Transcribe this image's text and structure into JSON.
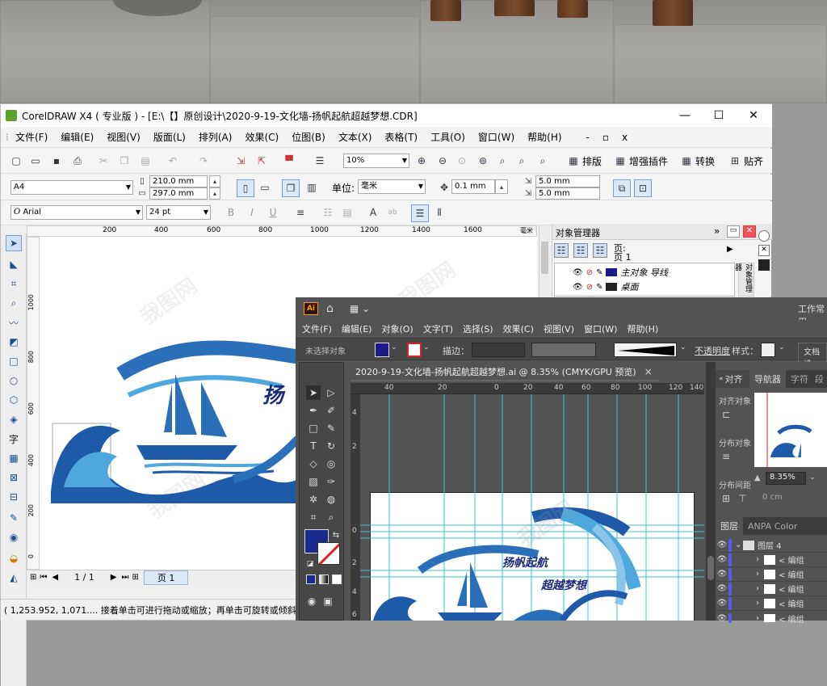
{
  "corel": {
    "title": "CorelDRAW X4 ( 专业版 ) - [E:\\【】原创设计\\2020-9-19-文化墙-扬帆起航超越梦想.CDR]",
    "window_controls": [
      "—",
      "☐",
      "✕"
    ],
    "menu": [
      "文件(F)",
      "编辑(E)",
      "视图(V)",
      "版面(L)",
      "排列(A)",
      "效果(C)",
      "位图(B)",
      "文本(X)",
      "表格(T)",
      "工具(O)",
      "窗口(W)",
      "帮助(H)"
    ],
    "mdi_controls": [
      "-",
      "▫",
      "x"
    ],
    "toolbar1": {
      "zoom": "10%",
      "plugins": [
        "排版",
        "增强插件",
        "转换",
        "贴齐"
      ]
    },
    "property_bar": {
      "page_size": "A4",
      "width": "210.0 mm",
      "height": "297.0 mm",
      "unit_label": "单位:",
      "unit": "毫米",
      "nudge": "0.1 mm",
      "dup_x": "5.0 mm",
      "dup_y": "5.0 mm"
    },
    "text_bar": {
      "font": "Arial",
      "size": "24 pt"
    },
    "ruler_top": [
      "200",
      "400",
      "600",
      "800",
      "1000",
      "1200",
      "1400",
      "1600"
    ],
    "ruler_unit": "毫米",
    "ruler_left": [
      "1000",
      "800",
      "600",
      "400",
      "200",
      "0",
      "200"
    ],
    "artwork_title": "扬",
    "page_nav": {
      "pages": "1 / 1",
      "tab": "页 1"
    },
    "status": "( 1,253.952, 1,071.... 接着单击可进行拖动或缩放；再单击可旋转或倾斜",
    "object_manager": {
      "title": "对象管理器",
      "page_label": "页:",
      "page_value": "页 1",
      "layers": [
        "主对象 导线",
        "桌面"
      ],
      "side_tab": "对象管理器"
    }
  },
  "ai": {
    "logo": "Ai",
    "workspace": "工作常用",
    "menu": [
      "文件(F)",
      "编辑(E)",
      "对象(O)",
      "文字(T)",
      "选择(S)",
      "效果(C)",
      "视图(V)",
      "窗口(W)",
      "帮助(H)"
    ],
    "control_bar": {
      "no_selection": "未选择对象",
      "stroke_label": "描边：",
      "opacity_label": "不透明度",
      "style_label": "样式：",
      "doc_settings": "文档设"
    },
    "doc_tab": "2020-9-19-文化墙-扬帆起航超越梦想.ai @ 8.35% (CMYK/GPU 预览)",
    "doc_close": "×",
    "ruler_top": [
      "40",
      "20",
      "0",
      "20",
      "40",
      "60",
      "80",
      "100",
      "120",
      "140"
    ],
    "ruler_left": [
      "4",
      "2",
      "0",
      "2",
      "4",
      "6"
    ],
    "art_title_1": "扬帆起航",
    "art_title_2": "超越梦想",
    "panels": {
      "align_tab": "对齐",
      "align_objects": "对齐对象",
      "distribute_objects": "分布对象",
      "distribute_spacing": "分布间距",
      "navigator_tab": "导航器",
      "char_tab": "字符",
      "extra_tab": "段",
      "zoom": "8.35%",
      "unit": "0 cm",
      "layers_tab": "图层",
      "anpa_tab": "ANPA Color",
      "layer_name": "图层 4",
      "sub_layers": [
        "< 编组",
        "< 编组",
        "< 编组",
        "< 编组",
        "< 编组"
      ]
    }
  },
  "colors": {
    "ai_accent": "#1a1a8c",
    "wave_dark": "#1e5aa8",
    "wave_light": "#4ea8de",
    "guide": "#39c3d6"
  }
}
